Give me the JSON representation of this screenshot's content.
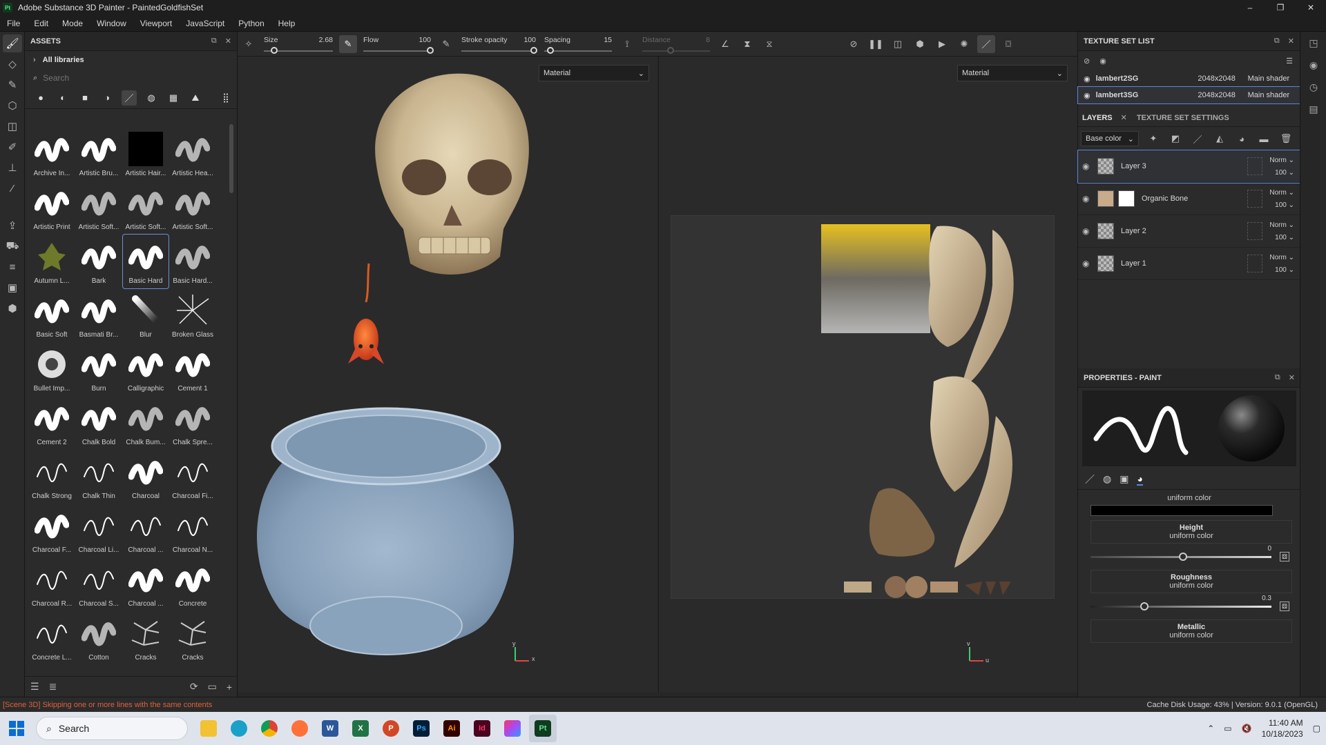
{
  "window": {
    "title": "Adobe Substance 3D Painter - PaintedGoldfishSet",
    "logo": "Pt",
    "min": "–",
    "max": "❐",
    "close": "✕"
  },
  "menu": [
    "File",
    "Edit",
    "Mode",
    "Window",
    "Viewport",
    "JavaScript",
    "Python",
    "Help"
  ],
  "assets": {
    "header": "ASSETS",
    "library": "All libraries",
    "search_placeholder": "Search",
    "items": [
      "Archive In...",
      "Artistic Bru...",
      "Artistic Hair...",
      "Artistic Hea...",
      "Artistic Print",
      "Artistic Soft...",
      "Artistic Soft...",
      "Artistic Soft...",
      "Autumn L...",
      "Bark",
      "Basic Hard",
      "Basic Hard...",
      "Basic Soft",
      "Basmati Br...",
      "Blur",
      "Broken Glass",
      "Bullet Imp...",
      "Burn",
      "Calligraphic",
      "Cement 1",
      "Cement 2",
      "Chalk Bold",
      "Chalk Bum...",
      "Chalk Spre...",
      "Chalk Strong",
      "Chalk Thin",
      "Charcoal",
      "Charcoal Fi...",
      "Charcoal F...",
      "Charcoal Li...",
      "Charcoal ...",
      "Charcoal N...",
      "Charcoal R...",
      "Charcoal S...",
      "Charcoal ...",
      "Concrete",
      "Concrete L...",
      "Cotton",
      "Cracks",
      "Cracks"
    ],
    "selected_index": 10
  },
  "toolbar": {
    "size": {
      "label": "Size",
      "value": "2.68"
    },
    "flow": {
      "label": "Flow",
      "value": "100"
    },
    "stroke_opacity": {
      "label": "Stroke opacity",
      "value": "100"
    },
    "spacing": {
      "label": "Spacing",
      "value": "15"
    },
    "distance": {
      "label": "Distance",
      "value": "8"
    }
  },
  "viewport": {
    "left_mode": "Material",
    "right_mode": "Material",
    "axis_3d": "x",
    "axis_3d_y": "y",
    "axis_2d": "u",
    "axis_2d_v": "v"
  },
  "texture_sets": {
    "header": "TEXTURE SET LIST",
    "rows": [
      {
        "name": "lambert2SG",
        "size": "2048x2048",
        "shader": "Main shader"
      },
      {
        "name": "lambert3SG",
        "size": "2048x2048",
        "shader": "Main shader"
      }
    ]
  },
  "layers": {
    "tab_layers": "LAYERS",
    "tab_settings": "TEXTURE SET SETTINGS",
    "channel": "Base color",
    "rows": [
      {
        "name": "Layer 3",
        "blend": "Norm",
        "opacity": "100"
      },
      {
        "name": "Organic Bone",
        "blend": "Norm",
        "opacity": "100"
      },
      {
        "name": "Layer 2",
        "blend": "Norm",
        "opacity": "100"
      },
      {
        "name": "Layer 1",
        "blend": "Norm",
        "opacity": "100"
      }
    ]
  },
  "properties": {
    "header": "PROPERTIES - PAINT",
    "color_sub": "uniform color",
    "height": {
      "title": "Height",
      "sub": "uniform color",
      "value": "0"
    },
    "roughness": {
      "title": "Roughness",
      "sub": "uniform color",
      "value": "0.3"
    },
    "metallic": {
      "title": "Metallic",
      "sub": "uniform color"
    }
  },
  "status": {
    "message": "[Scene 3D] Skipping one or more lines with the same contents",
    "cache": "Cache Disk Usage:",
    "cache_value": "43%",
    "sep": "|",
    "version": "Version: 9.0.1 (OpenGL)"
  },
  "taskbar": {
    "search": "Search",
    "apps": [
      "Ps",
      "Ai",
      "Id",
      "Pt"
    ],
    "time": "11:40 AM",
    "date": "10/18/2023"
  }
}
